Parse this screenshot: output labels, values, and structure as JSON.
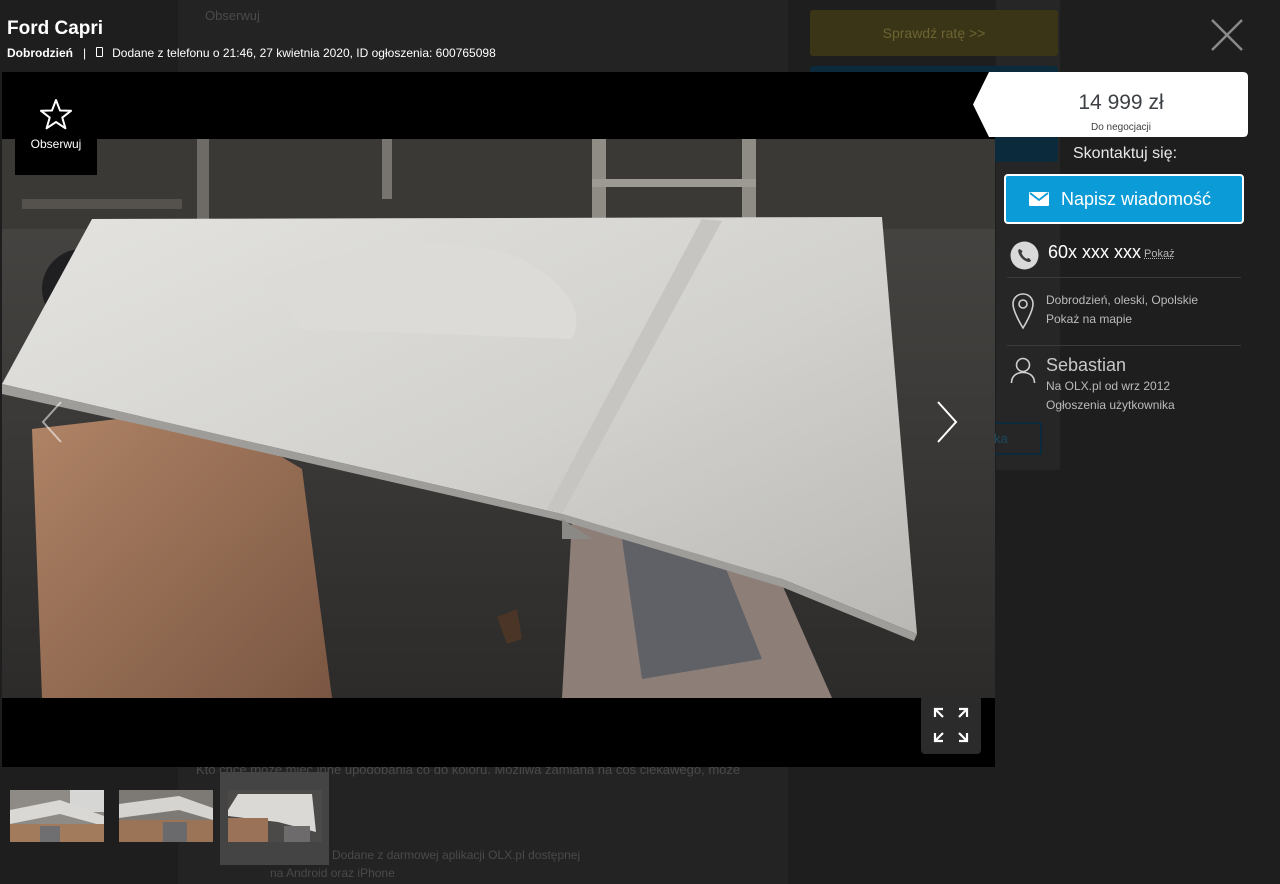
{
  "listing": {
    "title": "Ford Capri",
    "location": "Dobrodzień",
    "separator": "|",
    "added_info": "Dodane z telefonu o 21:46, 27 kwietnia 2020, ID ogłoszenia: 600765098"
  },
  "viewer": {
    "follow_label": "Obserwuj",
    "photo_description": "white car hood panel on masking paper in workshop"
  },
  "price": {
    "amount": "14 999 zł",
    "note": "Do negocjacji"
  },
  "contact": {
    "heading": "Skontaktuj się:",
    "message_button": "Napisz wiadomość",
    "phone": "60x xxx xxx",
    "show_phone": "Pokaż",
    "address": "Dobrodzień, oleski, Opolskie",
    "show_map": "Pokaż na mapie",
    "seller_name": "Sebastian",
    "seller_since": "Na OLX.pl od wrz 2012",
    "seller_ads": "Ogłoszenia użytkownika"
  },
  "thumbnails": {
    "count": 3,
    "selected_index": 2
  },
  "background_page": {
    "follow_text": "Obserwuj",
    "check_rate_button": "Sprawdź ratę >>",
    "desc_line": "Kto chce może mieć inne upodobania co do koloru. Możliwa zamiana na coś ciekawego, może",
    "app_line_1": "Dodane z darmowej aplikacji OLX.pl dostępnej",
    "app_line_2": "na Android oraz iPhone",
    "outline_btn_fragment": "ka"
  },
  "colors": {
    "accent_blue": "#0b9bd6",
    "price_text": "#3d4145",
    "overlay_bg": "#1e1e1e"
  }
}
